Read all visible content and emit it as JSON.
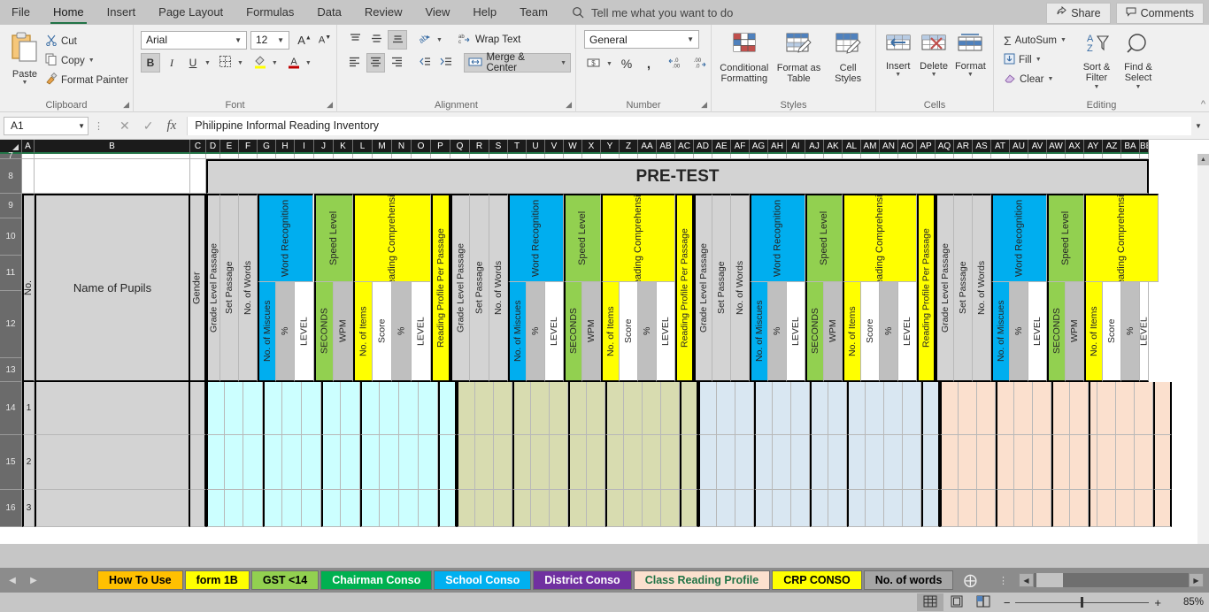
{
  "ribbon": {
    "tabs": [
      "File",
      "Home",
      "Insert",
      "Page Layout",
      "Formulas",
      "Data",
      "Review",
      "View",
      "Help",
      "Team"
    ],
    "active_tab": "Home",
    "tell_me": "Tell me what you want to do",
    "share_label": "Share",
    "comments_label": "Comments",
    "groups": {
      "clipboard": {
        "title": "Clipboard",
        "paste": "Paste",
        "cut": "Cut",
        "copy": "Copy",
        "format_painter": "Format Painter"
      },
      "font": {
        "title": "Font",
        "font_name": "Arial",
        "font_size": "12",
        "grow": "A",
        "shrink": "A",
        "bold": "B",
        "italic": "I",
        "underline": "U"
      },
      "alignment": {
        "title": "Alignment",
        "wrap_text": "Wrap Text",
        "merge_center": "Merge & Center"
      },
      "number": {
        "title": "Number",
        "format": "General",
        "percent": "%",
        "comma": ",",
        "inc_dec": ".00",
        "dec_dec": ".00"
      },
      "styles": {
        "title": "Styles",
        "conditional_formatting": "Conditional Formatting",
        "format_as_table": "Format as Table",
        "cell_styles": "Cell Styles"
      },
      "cells": {
        "title": "Cells",
        "insert": "Insert",
        "delete": "Delete",
        "format": "Format"
      },
      "editing": {
        "title": "Editing",
        "autosum": "AutoSum",
        "fill": "Fill",
        "clear": "Clear",
        "sort_filter": "Sort & Filter",
        "find_select": "Find & Select"
      }
    }
  },
  "formula_bar": {
    "name_box": "A1",
    "cancel": "✕",
    "enter": "✓",
    "fx": "fx",
    "content": "Philippine Informal Reading Inventory"
  },
  "grid": {
    "columns": [
      "A",
      "B",
      "C",
      "D",
      "E",
      "F",
      "G",
      "H",
      "I",
      "J",
      "K",
      "L",
      "M",
      "N",
      "O",
      "P",
      "Q",
      "R",
      "S",
      "T",
      "U",
      "V",
      "W",
      "X",
      "Y",
      "Z",
      "AA",
      "AB",
      "AC",
      "AD",
      "AE",
      "AF",
      "AG",
      "AH",
      "AI",
      "AJ",
      "AK",
      "AL",
      "AM",
      "AN",
      "AO",
      "AP",
      "AQ",
      "AR",
      "AS",
      "AT",
      "AU",
      "AV",
      "AW",
      "AX",
      "AY",
      "AZ",
      "BA",
      "BB"
    ],
    "rows": [
      "7",
      "8",
      "9",
      "10",
      "11",
      "12",
      "13",
      "14",
      "15",
      "16"
    ],
    "banner": "PRE-TEST",
    "left_headers": {
      "no": "No.",
      "name_of_pupils": "Name of Pupils",
      "gender": "Gender"
    },
    "group_headers": {
      "grade_level_passage": "Grade Level Passage",
      "set_passage": "Set Passage",
      "no_of_words": "No. of Words",
      "word_recognition": "Word Recognition",
      "speed_level": "Speed Level",
      "reading_comprehension": "Reading Comprehension",
      "reading_profile_per_passage": "Reading Profile Per Passage"
    },
    "sub_headers": {
      "no_of_miscues": "No. of Miscues",
      "percent": "%",
      "level": "LEVEL",
      "seconds": "SECONDS",
      "wpm": "WPM",
      "no_of_items": "No. of Items",
      "score": "Score"
    },
    "row_numbers": [
      "1",
      "2",
      "3"
    ],
    "colors": {
      "word_recognition": "#00AEEF",
      "speed_level": "#92D050",
      "reading_comprehension": "#FFFF00",
      "band1": "#CCFFFF",
      "band2": "#D8DCB0",
      "band3": "#D9E7F2",
      "band4": "#FBE0CE",
      "header_gray": "#D3D3D3",
      "sub_gray": "#BFBFBF"
    }
  },
  "sheet_tabs": [
    {
      "label": "How To Use",
      "bg": "#FFC000",
      "fg": "#000000"
    },
    {
      "label": "form 1B",
      "bg": "#FFFF00",
      "fg": "#000000"
    },
    {
      "label": "GST <14",
      "bg": "#92D050",
      "fg": "#000000"
    },
    {
      "label": "Chairman Conso",
      "bg": "#00B050",
      "fg": "#FFFFFF"
    },
    {
      "label": "School Conso",
      "bg": "#00B0F0",
      "fg": "#FFFFFF"
    },
    {
      "label": "District Conso",
      "bg": "#7030A0",
      "fg": "#FFFFFF"
    },
    {
      "label": "Class Reading Profile",
      "bg": "#FBE0CE",
      "fg": "#217346",
      "active": true
    },
    {
      "label": "CRP CONSO",
      "bg": "#FFFF00",
      "fg": "#000000"
    },
    {
      "label": "No. of words",
      "bg": "#A6A6A6",
      "fg": "#000000"
    }
  ],
  "status_bar": {
    "zoom": "85%",
    "add_sheet": "+",
    "views": [
      "normal-view",
      "page-layout-view",
      "page-break-view"
    ],
    "zoom_out": "−",
    "zoom_in": "+"
  }
}
